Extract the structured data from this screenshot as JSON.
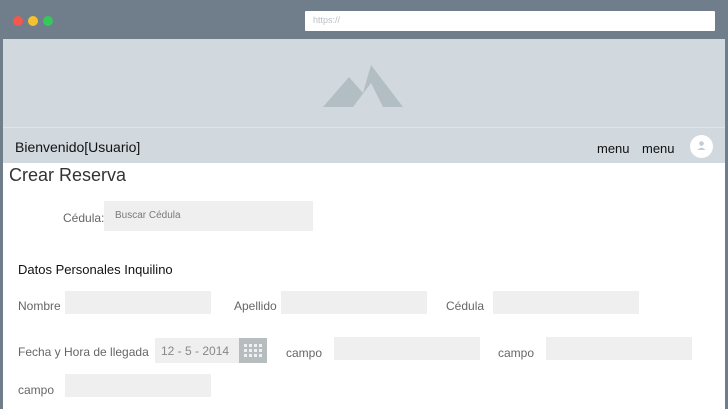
{
  "browser": {
    "url_placeholder": "https://"
  },
  "header": {
    "welcome": "Bienvenido[Usuario]",
    "menu_items": [
      "menu",
      "menu"
    ]
  },
  "page": {
    "title": "Crear Reserva"
  },
  "search": {
    "label": "Cédula:",
    "placeholder": "Buscar Cédula"
  },
  "section": {
    "title": "Datos Personales Inquilino"
  },
  "form": {
    "nombre_label": "Nombre",
    "apellido_label": "Apellido",
    "cedula_label": "Cédula",
    "fecha_label": "Fecha y Hora de llegada",
    "fecha_value": "12 - 5 - 2014",
    "campo1_label": "campo",
    "campo2_label": "campo",
    "campo3_label": "campo"
  },
  "colors": {
    "titlebar": "#6f7e8a",
    "hero": "#d1d8de",
    "field": "#efefef"
  }
}
